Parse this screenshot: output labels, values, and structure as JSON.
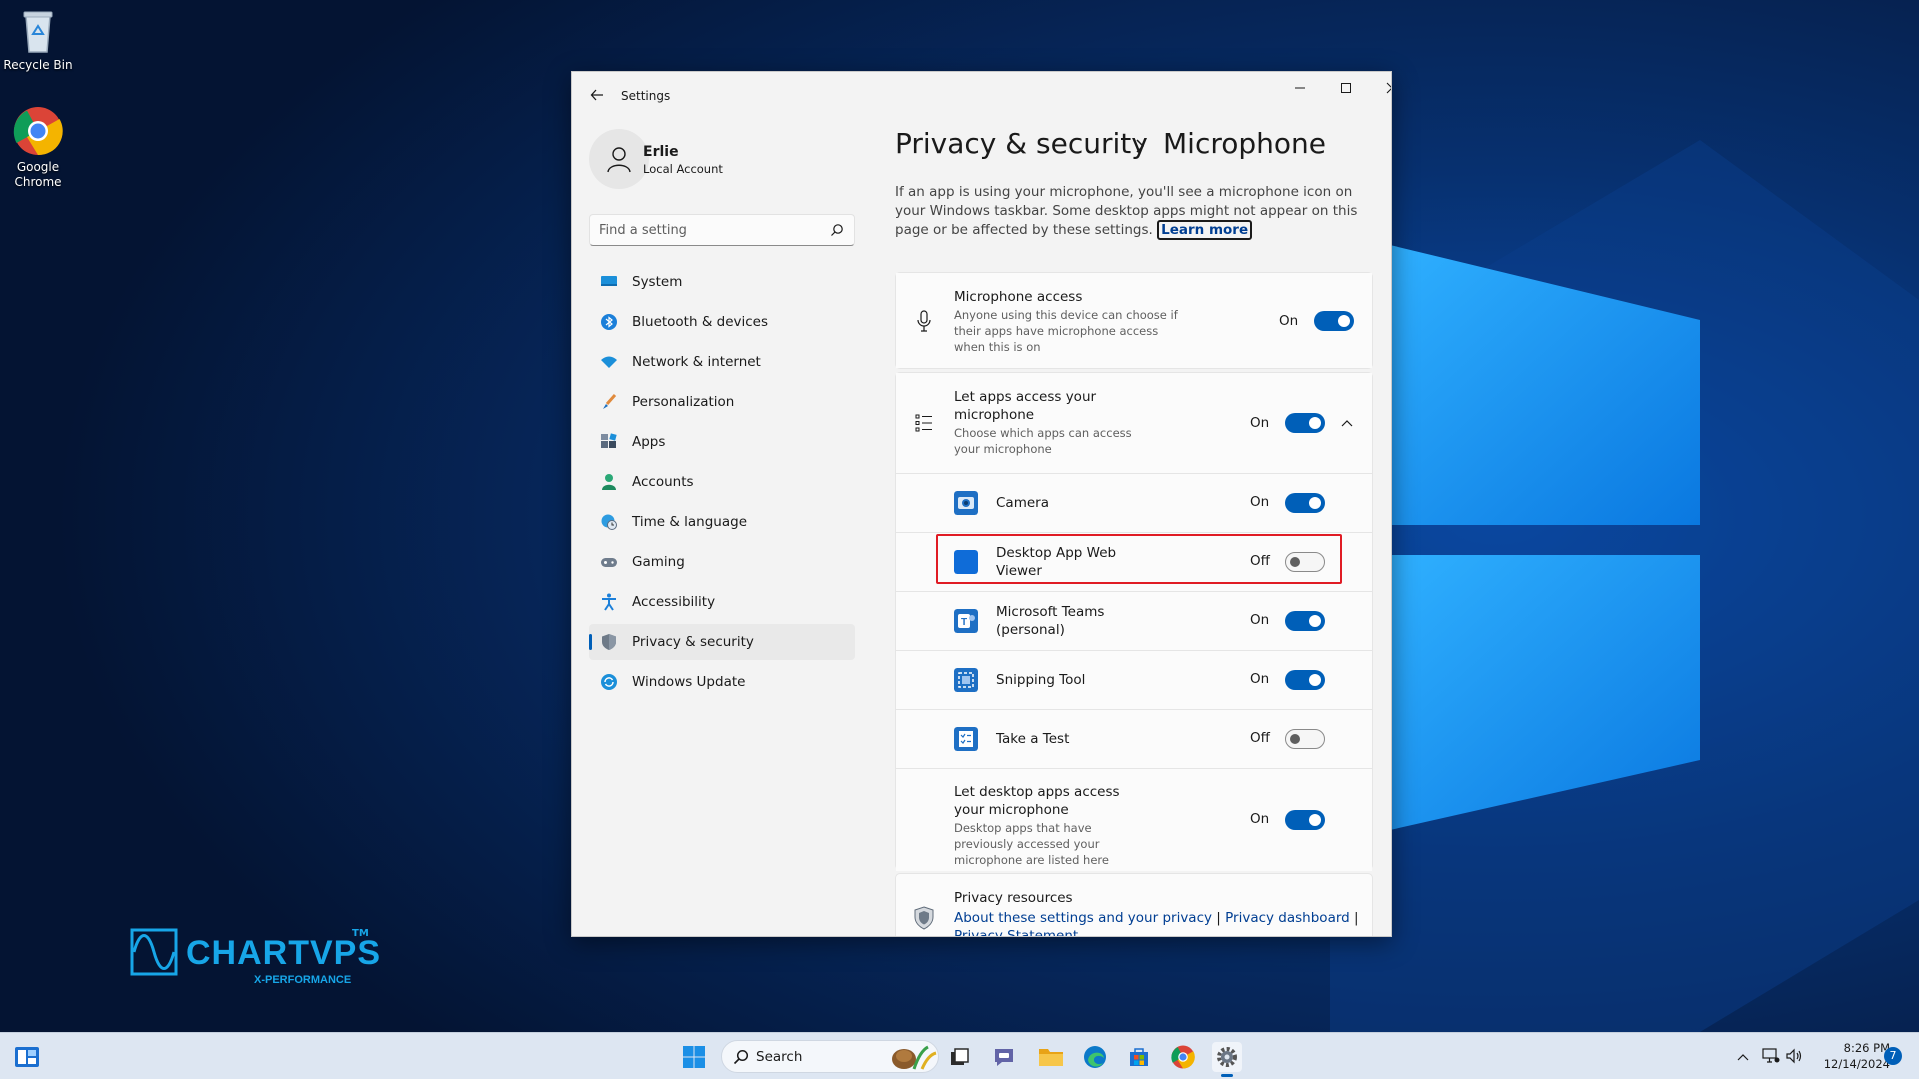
{
  "desktop": {
    "icons": [
      {
        "label": "Recycle Bin"
      },
      {
        "label": "Google Chrome"
      }
    ],
    "brand": {
      "name": "CHARTVPS",
      "tm": "TM",
      "tagline": "X-PERFORMANCE"
    }
  },
  "window": {
    "title": "Settings",
    "user": {
      "name": "Erlie",
      "account_type": "Local Account"
    },
    "search_placeholder": "Find a setting",
    "nav": [
      {
        "label": "System",
        "icon": "monitor-icon"
      },
      {
        "label": "Bluetooth & devices",
        "icon": "bluetooth-icon"
      },
      {
        "label": "Network & internet",
        "icon": "wifi-icon"
      },
      {
        "label": "Personalization",
        "icon": "brush-icon"
      },
      {
        "label": "Apps",
        "icon": "apps-icon"
      },
      {
        "label": "Accounts",
        "icon": "person-icon"
      },
      {
        "label": "Time & language",
        "icon": "globe-clock-icon"
      },
      {
        "label": "Gaming",
        "icon": "gamepad-icon"
      },
      {
        "label": "Accessibility",
        "icon": "accessibility-icon"
      },
      {
        "label": "Privacy & security",
        "icon": "shield-icon",
        "selected": true
      },
      {
        "label": "Windows Update",
        "icon": "update-icon"
      }
    ],
    "breadcrumb": {
      "parent": "Privacy & security",
      "separator": "›",
      "current": "Microphone"
    },
    "description": "If an app is using your microphone, you'll see a microphone icon on your Windows taskbar. Some desktop apps might not appear on this page or be affected by these settings.",
    "learn_more": "Learn more",
    "microphone_access": {
      "title": "Microphone access",
      "subtitle": "Anyone using this device can choose if their apps have microphone access when this is on",
      "state": "On"
    },
    "let_apps": {
      "title": "Let apps access your microphone",
      "subtitle": "Choose which apps can access your microphone",
      "state": "On"
    },
    "apps": [
      {
        "name": "Camera",
        "state": "On",
        "icon": "camera-icon"
      },
      {
        "name": "Desktop App Web Viewer",
        "state": "Off",
        "icon": "web-viewer-icon"
      },
      {
        "name": "Microsoft Teams (personal)",
        "state": "On",
        "icon": "teams-icon"
      },
      {
        "name": "Snipping Tool",
        "state": "On",
        "icon": "snipping-tool-icon"
      },
      {
        "name": "Take a Test",
        "state": "Off",
        "icon": "take-a-test-icon"
      }
    ],
    "desktop_apps": {
      "title": "Let desktop apps access your microphone",
      "subtitle": "Desktop apps that have previously accessed your microphone are listed here",
      "state": "On"
    },
    "privacy_resources": {
      "title": "Privacy resources",
      "link1": "About these settings and your privacy",
      "link2": "Privacy dashboard",
      "link3": "Privacy Statement"
    }
  },
  "taskbar": {
    "search_label": "Search",
    "time": "8:26 PM",
    "date": "12/14/2024",
    "notifications": "7"
  },
  "colors": {
    "accent": "#005fb8",
    "highlight": "#e01b24",
    "brand": "#17a6e8"
  }
}
